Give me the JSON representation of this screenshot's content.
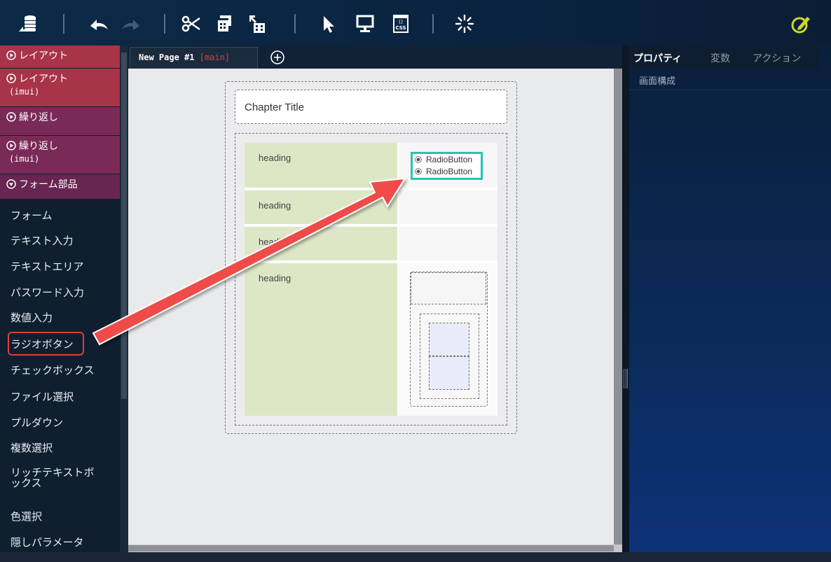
{
  "colors": {
    "toolbar_bg": "#0c2a47",
    "layout_category": "#a8344a",
    "repeat_category": "#7a2a56",
    "form_category": "#692552",
    "highlight_red": "#e23b3b",
    "heading_cell": "#dde7c6",
    "radio_selection": "#27c3b0",
    "edit_icon": "#c9d92a"
  },
  "toolbar": {
    "icons": [
      "database-icon",
      "undo-icon",
      "redo-icon",
      "cut-icon",
      "copy-icon",
      "move-icon",
      "pointer-icon",
      "monitor-icon",
      "css-icon",
      "loading-icon",
      "edit-pencil-icon"
    ],
    "css_label": "CSS"
  },
  "sidebar": {
    "categories": [
      {
        "label": "レイアウト",
        "sub": ""
      },
      {
        "label": "レイアウト",
        "sub": "(imui)"
      },
      {
        "label": "繰り返し",
        "sub": ""
      },
      {
        "label": "繰り返し",
        "sub": "(imui)"
      },
      {
        "label": "フォーム部品",
        "sub": ""
      }
    ],
    "items": [
      "フォーム",
      "テキスト入力",
      "テキストエリア",
      "パスワード入力",
      "数値入力",
      "ラジオボタン",
      "チェックボックス",
      "ファイル選択",
      "プルダウン",
      "複数選択",
      "リッチテキストボ",
      "ックス",
      "色選択",
      "隠しパラメータ"
    ]
  },
  "tabs": {
    "main_tab": "New Page #1",
    "main_tab_branch": "[main]"
  },
  "canvas": {
    "chapter_title": "Chapter Title",
    "headings": [
      "heading",
      "heading",
      "heading",
      "heading"
    ],
    "radio_buttons": [
      "RadioButton",
      "RadioButton"
    ]
  },
  "right_panel": {
    "tabs": [
      "プロパティ",
      "変数",
      "アクション"
    ],
    "section": "画面構成"
  }
}
